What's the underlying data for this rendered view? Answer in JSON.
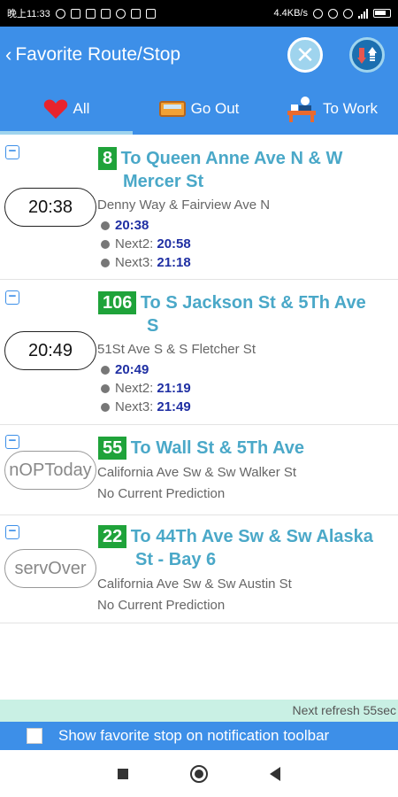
{
  "statusbar": {
    "time": "晚上11:33",
    "speed": "4.4KB/s"
  },
  "header": {
    "back": "‹",
    "title": "Favorite Route/Stop"
  },
  "tabs": [
    {
      "label": "All",
      "icon": "heart-icon"
    },
    {
      "label": "Go Out",
      "icon": "bus-icon"
    },
    {
      "label": "To Work",
      "icon": "desk-icon"
    }
  ],
  "favorites": [
    {
      "pill": "20:38",
      "route": "8",
      "dest_line1": "To Queen Anne Ave N & W",
      "dest_line2": "Mercer St",
      "stop": "Denny Way & Fairview Ave N",
      "pred1": "20:38",
      "next2_label": "Next2:",
      "next2": "20:58",
      "next3_label": "Next3:",
      "next3": "21:18"
    },
    {
      "pill": "20:49",
      "route": "106",
      "dest_line1": "To S Jackson St & 5Th Ave",
      "dest_line2": "S",
      "stop": "51St Ave S & S Fletcher St",
      "pred1": "20:49",
      "next2_label": "Next2:",
      "next2": "21:19",
      "next3_label": "Next3:",
      "next3": "21:49"
    },
    {
      "pill": "nOPToday",
      "route": "55",
      "dest_line1": "To Wall St & 5Th Ave",
      "stop": "California Ave Sw & Sw Walker St",
      "status": "No Current Prediction"
    },
    {
      "pill": "servOver",
      "route": "22",
      "dest_line1": "To 44Th Ave Sw & Sw Alaska",
      "dest_line2": "St - Bay 6",
      "stop": "California Ave Sw & Sw Austin St",
      "status": "No Current Prediction"
    }
  ],
  "footer": {
    "refresh": "Next refresh 55sec",
    "notify_label": "Show favorite stop on notification toolbar"
  },
  "colors": {
    "header": "#3d8fe8",
    "route_badge": "#1fa33a",
    "destination": "#4aa8c8",
    "prediction": "#1f2fa3"
  }
}
